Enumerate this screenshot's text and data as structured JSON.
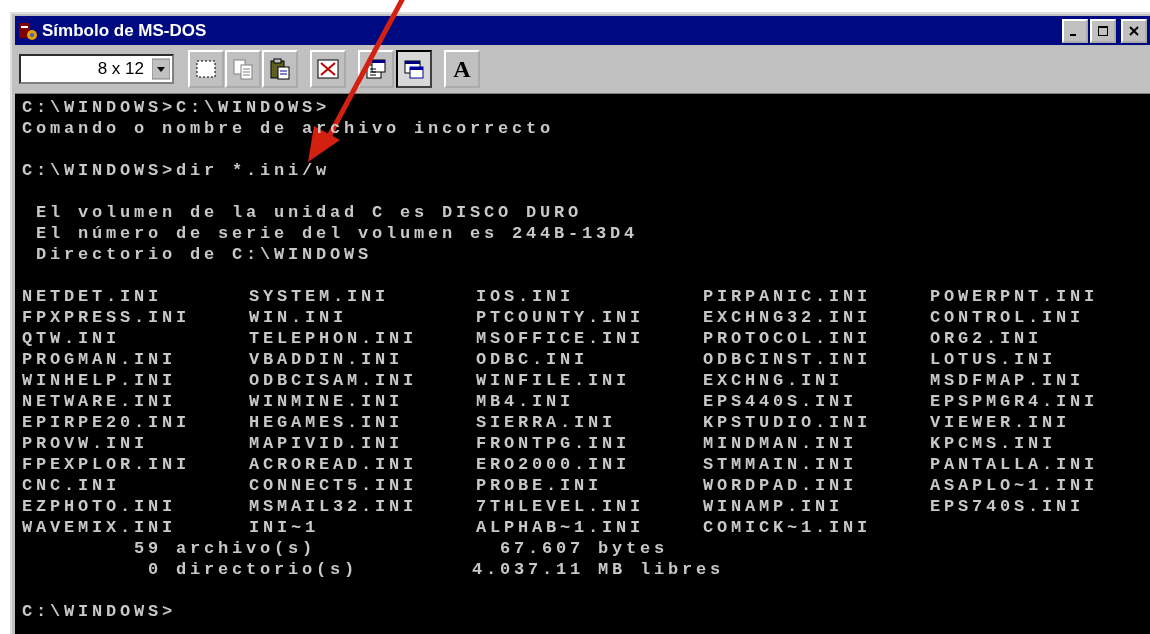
{
  "window": {
    "title": "Símbolo de MS-DOS"
  },
  "toolbar": {
    "font_size": "8 x 12",
    "font_button": "A"
  },
  "console": {
    "blocks": [
      {
        "kind": "lines",
        "lines": [
          "C:\\WINDOWS>C:\\WINDOWS>",
          "Comando o nombre de archivo incorrecto"
        ]
      },
      {
        "kind": "lines",
        "lines": [
          "C:\\WINDOWS>dir *.ini/w"
        ]
      },
      {
        "kind": "info",
        "lines": [
          "El volumen de la unidad C es DISCO DURO",
          "El número de serie del volumen es 244B-13D4",
          "Directorio de C:\\WINDOWS"
        ]
      },
      {
        "kind": "files",
        "files": [
          "NETDET.INI",
          "SYSTEM.INI",
          "IOS.INI",
          "PIRPANIC.INI",
          "POWERPNT.INI",
          "FPXPRESS.INI",
          "WIN.INI",
          "PTCOUNTY.INI",
          "EXCHNG32.INI",
          "CONTROL.INI",
          "QTW.INI",
          "TELEPHON.INI",
          "MSOFFICE.INI",
          "PROTOCOL.INI",
          "ORG2.INI",
          "PROGMAN.INI",
          "VBADDIN.INI",
          "ODBC.INI",
          "ODBCINST.INI",
          "LOTUS.INI",
          "WINHELP.INI",
          "ODBCISAM.INI",
          "WINFILE.INI",
          "EXCHNG.INI",
          "MSDFMAP.INI",
          "NETWARE.INI",
          "WINMINE.INI",
          "MB4.INI",
          "EPS440S.INI",
          "EPSPMGR4.INI",
          "EPIRPE20.INI",
          "HEGAMES.INI",
          "SIERRA.INI",
          "KPSTUDIO.INI",
          "VIEWER.INI",
          "PROVW.INI",
          "MAPIVID.INI",
          "FRONTPG.INI",
          "MINDMAN.INI",
          "KPCMS.INI",
          "FPEXPLOR.INI",
          "ACROREAD.INI",
          "ERO2000.INI",
          "STMMAIN.INI",
          "PANTALLA.INI",
          "CNC.INI",
          "CONNECT5.INI",
          "PROBE.INI",
          "WORDPAD.INI",
          "ASAPLO~1.INI",
          "EZPHOTO.INI",
          "MSMAIL32.INI",
          "7THLEVEL.INI",
          "WINAMP.INI",
          "EPS740S.INI",
          "WAVEMIX.INI",
          "INI~1",
          "ALPHAB~1.INI",
          "COMICK~1.INI"
        ]
      },
      {
        "kind": "summary",
        "rows": [
          {
            "count": "59",
            "count_label": "archivo(s)",
            "amount": "67.607",
            "amount_label": "bytes"
          },
          {
            "count": "0",
            "count_label": "directorio(s)",
            "amount": "4.037.11",
            "amount_label": "MB libres"
          }
        ]
      },
      {
        "kind": "lines",
        "lines": [
          "C:\\WINDOWS>"
        ]
      }
    ]
  }
}
